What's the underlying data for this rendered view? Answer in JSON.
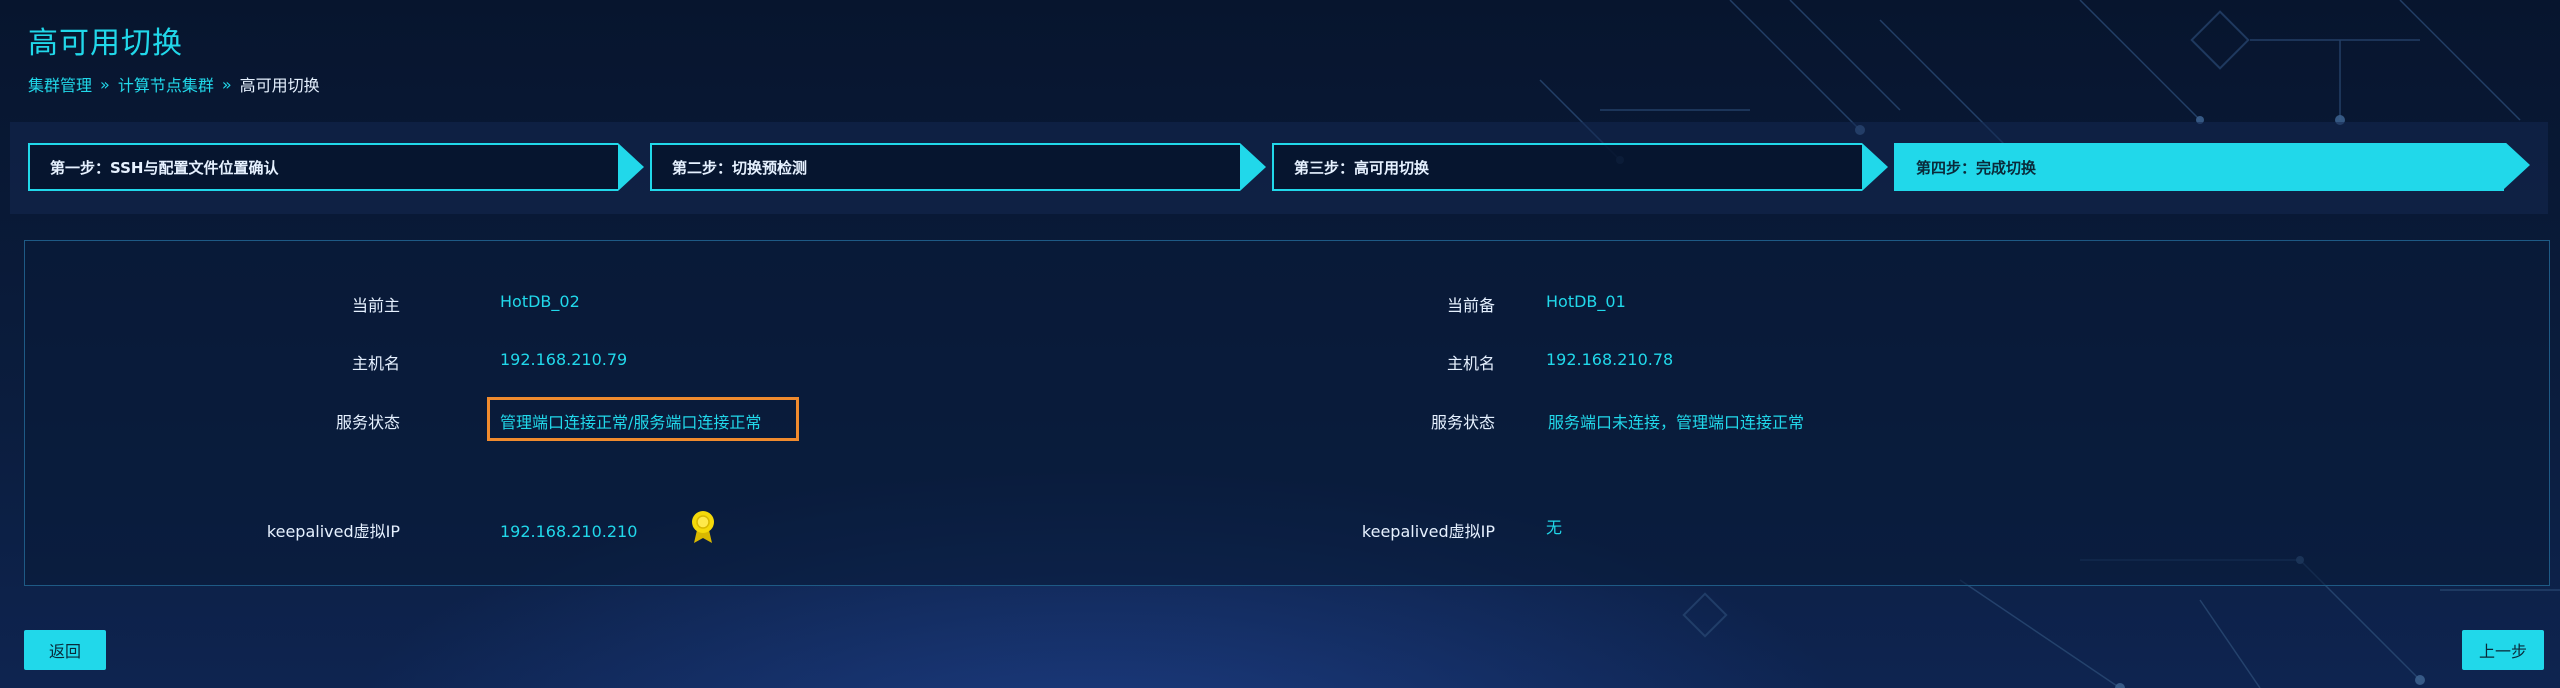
{
  "header": {
    "title": "高可用切换",
    "breadcrumb": [
      {
        "label": "集群管理"
      },
      {
        "label": "计算节点集群"
      },
      {
        "label": "高可用切换"
      }
    ],
    "separator": "»"
  },
  "steps": [
    {
      "label": "第一步：SSH与配置文件位置确认",
      "active": false
    },
    {
      "label": "第二步：切换预检测",
      "active": false
    },
    {
      "label": "第三步：高可用切换",
      "active": false
    },
    {
      "label": "第四步：完成切换",
      "active": true
    }
  ],
  "master": {
    "label_role": "当前主",
    "role_value": "HotDB_02",
    "label_host": "主机名",
    "host_value": "192.168.210.79",
    "label_status": "服务状态",
    "status_value": "管理端口连接正常/服务端口连接正常",
    "label_vip": "keepalived虚拟IP",
    "vip_value": "192.168.210.210"
  },
  "backup": {
    "label_role": "当前备",
    "role_value": "HotDB_01",
    "label_host": "主机名",
    "host_value": "192.168.210.78",
    "label_status": "服务状态",
    "status_value": "服务端口未连接，管理端口连接正常",
    "label_vip": "keepalived虚拟IP",
    "vip_value": "无"
  },
  "buttons": {
    "back": "返回",
    "prev": "上一步"
  },
  "colors": {
    "accent": "#21d8ea",
    "highlight": "#f08b2e",
    "badge": "#f5d90a"
  }
}
